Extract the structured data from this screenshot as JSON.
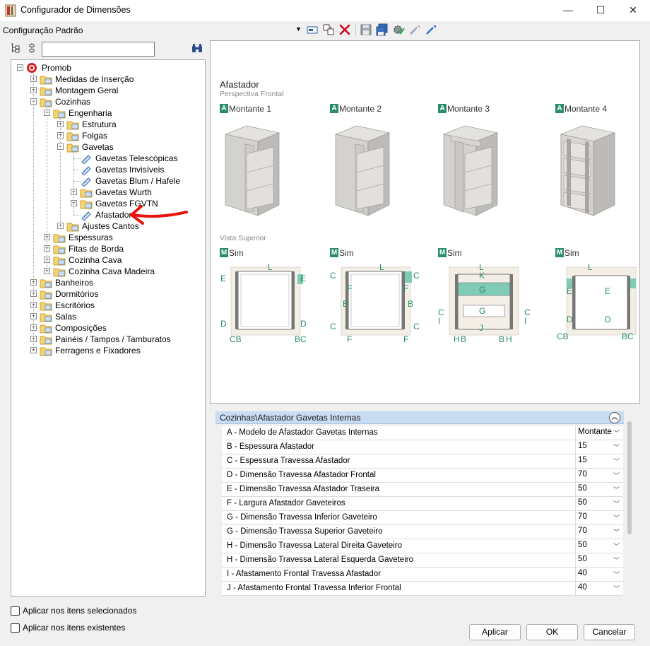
{
  "window": {
    "title": "Configurador de Dimensões",
    "minimize": "—",
    "maximize": "☐",
    "close": "✕"
  },
  "toolbar": {
    "config_label": "Configuração Padrão",
    "dropdown_glyph": "▼",
    "icons": [
      "edit-config-icon",
      "copy-config-icon",
      "delete-icon",
      "save-icon",
      "save-all-icon",
      "settings-check-icon",
      "import-icon",
      "export-icon"
    ]
  },
  "search": {
    "value": "",
    "placeholder": ""
  },
  "tree": {
    "nodes": [
      {
        "label": "Promob",
        "level": 0,
        "expanded": true,
        "icon": "promob-logo-icon"
      },
      {
        "label": "Medidas de Inserção",
        "level": 1,
        "expanded": false,
        "icon": "folder-icon"
      },
      {
        "label": "Montagem Geral",
        "level": 1,
        "expanded": false,
        "icon": "folder-icon"
      },
      {
        "label": "Cozinhas",
        "level": 1,
        "expanded": true,
        "icon": "folder-icon"
      },
      {
        "label": "Engenharia",
        "level": 2,
        "expanded": true,
        "icon": "folder-icon"
      },
      {
        "label": "Estrutura",
        "level": 3,
        "expanded": false,
        "icon": "folder-icon"
      },
      {
        "label": "Folgas",
        "level": 3,
        "expanded": false,
        "icon": "folder-icon"
      },
      {
        "label": "Gavetas",
        "level": 3,
        "expanded": true,
        "icon": "folder-icon"
      },
      {
        "label": "Gavetas Telescópicas",
        "level": 4,
        "leaf": true,
        "icon": "ruler-icon"
      },
      {
        "label": "Gavetas Invisíveis",
        "level": 4,
        "leaf": true,
        "icon": "ruler-icon"
      },
      {
        "label": "Gavetas Blum / Hafele",
        "level": 4,
        "leaf": true,
        "icon": "ruler-icon"
      },
      {
        "label": "Gavetas Wurth",
        "level": 4,
        "expanded": false,
        "icon": "folder-icon"
      },
      {
        "label": "Gavetas FGVTN",
        "level": 4,
        "expanded": false,
        "icon": "folder-icon"
      },
      {
        "label": "Afastador",
        "level": 4,
        "leaf": true,
        "icon": "ruler-icon",
        "selected": true
      },
      {
        "label": "Ajustes Cantos",
        "level": 3,
        "expanded": false,
        "icon": "folder-icon"
      },
      {
        "label": "Espessuras",
        "level": 2,
        "expanded": false,
        "icon": "folder-icon"
      },
      {
        "label": "Fitas de Borda",
        "level": 2,
        "expanded": false,
        "icon": "folder-icon"
      },
      {
        "label": "Cozinha Cava",
        "level": 2,
        "expanded": false,
        "icon": "folder-icon"
      },
      {
        "label": "Cozinha Cava Madeira",
        "level": 2,
        "expanded": false,
        "icon": "folder-icon"
      },
      {
        "label": "Banheiros",
        "level": 1,
        "expanded": false,
        "icon": "folder-icon"
      },
      {
        "label": "Dormitórios",
        "level": 1,
        "expanded": false,
        "icon": "folder-icon"
      },
      {
        "label": "Escritórios",
        "level": 1,
        "expanded": false,
        "icon": "folder-icon"
      },
      {
        "label": "Salas",
        "level": 1,
        "expanded": false,
        "icon": "folder-icon"
      },
      {
        "label": "Composições",
        "level": 1,
        "expanded": false,
        "icon": "folder-icon"
      },
      {
        "label": "Painéis / Tampos / Tamburatos",
        "level": 1,
        "expanded": false,
        "icon": "folder-icon"
      },
      {
        "label": "Ferragens e Fixadores",
        "level": 1,
        "expanded": false,
        "icon": "folder-icon"
      }
    ]
  },
  "preview": {
    "title": "Afastador",
    "subtitle_front": "Perspectiva Frontal",
    "subtitle_top": "Vista Superior",
    "badge_a": "A",
    "badge_m": "M",
    "montante_labels": [
      "Montante 1",
      "Montante 2",
      "Montante 3",
      "Montante 4"
    ],
    "sim_labels": [
      "Sim",
      "Sim",
      "Sim",
      "Sim"
    ],
    "dim_letters": {
      "L": "L",
      "E": "E",
      "D": "D",
      "CB": "CB",
      "BC": "BC",
      "C": "C",
      "F": "F",
      "B": "B",
      "K": "K",
      "G": "G",
      "I": "I",
      "H": "H",
      "J": "J"
    },
    "colors": {
      "teal": "#2a8c6e",
      "panel": "#f4efe6",
      "cabinet": "#d4d2cf",
      "highlight": "#7fcbb5"
    }
  },
  "properties": {
    "header": "Cozinhas\\Afastador Gavetas Internas",
    "collapse_glyph": "︽",
    "rows": [
      {
        "label": "A - Modelo de Afastador Gavetas Internas",
        "value": "Montante"
      },
      {
        "label": "B - Espessura Afastador",
        "value": "15"
      },
      {
        "label": "C - Espessura Travessa Afastador",
        "value": "15"
      },
      {
        "label": "D - Dimensão Travessa Afastador Frontal",
        "value": "70"
      },
      {
        "label": "E - Dimensão Travessa Afastador Traseira",
        "value": "50"
      },
      {
        "label": "F - Largura Afastador Gaveteiros",
        "value": "50"
      },
      {
        "label": "G - Dimensão Travessa Inferior Gaveteiro",
        "value": "70"
      },
      {
        "label": "G - Dimensão Travessa Superior Gaveteiro",
        "value": "70"
      },
      {
        "label": "H - Dimensão Travessa Lateral Direita Gaveteiro",
        "value": "50"
      },
      {
        "label": "H - Dimensão Travessa Lateral Esquerda Gaveteiro",
        "value": "50"
      },
      {
        "label": "I - Afastamento Frontal Travessa Afastador",
        "value": "40"
      },
      {
        "label": "J - Afastamento Frontal Travessa Inferior Frontal",
        "value": "40"
      }
    ]
  },
  "options": {
    "apply_selected": "Aplicar nos itens selecionados",
    "apply_existing": "Aplicar nos itens existentes"
  },
  "buttons": {
    "apply": "Aplicar",
    "ok": "OK",
    "cancel": "Cancelar"
  }
}
